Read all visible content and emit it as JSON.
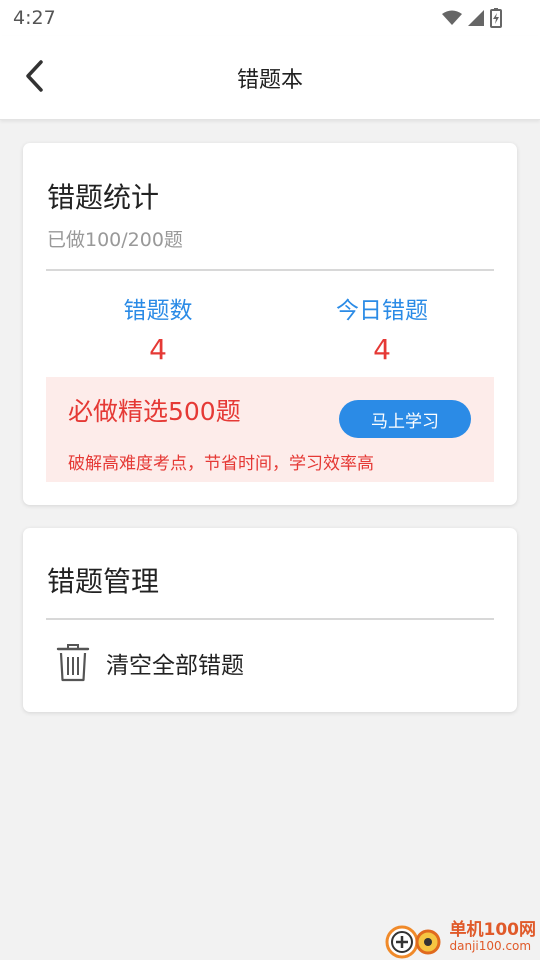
{
  "status_bar": {
    "time": "4:27"
  },
  "header": {
    "title": "错题本"
  },
  "stats_card": {
    "title": "错题统计",
    "progress_text": "已做100/200题",
    "wrong_count_label": "错题数",
    "wrong_count_value": "4",
    "today_wrong_label": "今日错题",
    "today_wrong_value": "4"
  },
  "promo": {
    "title": "必做精选500题",
    "button_label": "马上学习",
    "description": "破解高难度考点，节省时间，学习效率高"
  },
  "manage_card": {
    "title": "错题管理",
    "clear_all_label": "清空全部错题"
  },
  "watermark": {
    "name": "单机100网",
    "url": "danji100.com"
  },
  "colors": {
    "accent": "#2b8be6",
    "highlight": "#e53935",
    "promo_bg": "#fdecea"
  }
}
